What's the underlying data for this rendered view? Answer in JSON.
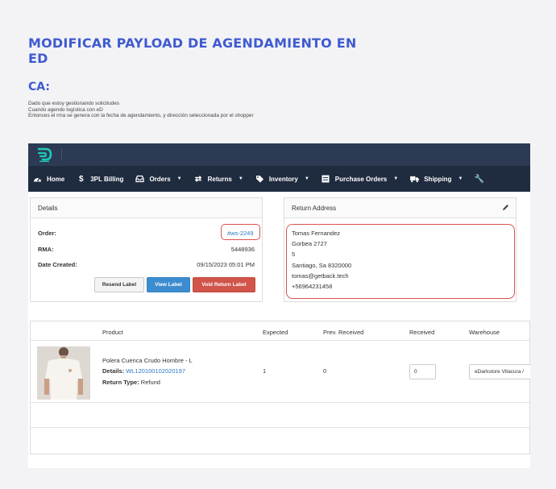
{
  "doc": {
    "title": "MODIFICAR PAYLOAD DE AGENDAMIENTO EN ED",
    "ca_label": "CA:",
    "lines": [
      "Dado que estoy gestionando solicitudes",
      "Cuando agendo logística con eD",
      "Entonces el rma se genera con la fecha de agendamiento, y dirección seleccionada por el shopper"
    ]
  },
  "nav": {
    "items": [
      {
        "label": "Home",
        "icon": "dashboard-icon"
      },
      {
        "label": "3PL Billing",
        "icon": "dollar-icon"
      },
      {
        "label": "Orders",
        "icon": "inbox-icon"
      },
      {
        "label": "Returns",
        "icon": "exchange-icon"
      },
      {
        "label": "Inventory",
        "icon": "tag-icon"
      },
      {
        "label": "Purchase Orders",
        "icon": "list-icon"
      },
      {
        "label": "Shipping",
        "icon": "truck-icon"
      }
    ]
  },
  "details": {
    "heading": "Details",
    "order_label": "Order:",
    "order_value": "#ws-2249",
    "rma_label": "RMA:",
    "rma_value": "5448936",
    "date_label": "Date Created:",
    "date_value": "09/15/2023 05:01 PM",
    "buttons": {
      "resend": "Resend Label",
      "view": "View Label",
      "void": "Void Return Label"
    }
  },
  "return_address": {
    "heading": "Return Address",
    "lines": [
      "Tomas Fernandez",
      "Gorbea 2727",
      "5",
      "Santiago, Sa 8320000",
      "tomas@getback.tech",
      "+56964231458"
    ]
  },
  "table": {
    "headers": [
      "Product",
      "Expected",
      "Prev. Received",
      "Received",
      "Warehouse"
    ],
    "row": {
      "product_name": "Polera Cuenca Crudo Hombre - L",
      "details_label": "Details:",
      "details_value": "WL120100102020197",
      "return_type_label": "Return Type:",
      "return_type_value": "Refund",
      "expected": "1",
      "prev_received": "0",
      "received": "0",
      "warehouse": "eDarkstore Vitacura / "
    }
  },
  "colors": {
    "accent": "#3f5bd0",
    "nav_bg": "#1f2b3f",
    "topbar_bg": "#2c3a53",
    "logo": "#1dc8b8",
    "highlight": "#d9534f"
  }
}
